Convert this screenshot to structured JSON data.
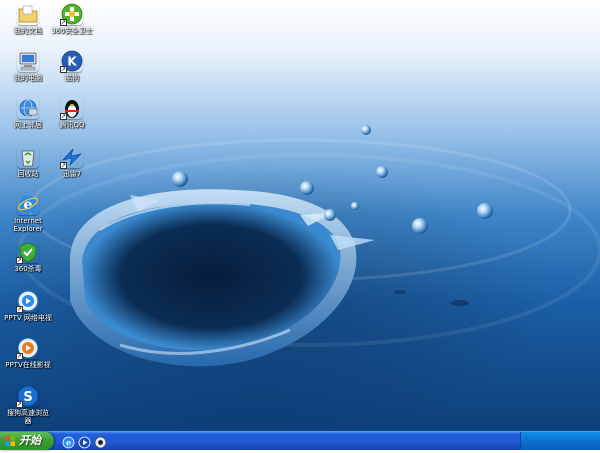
{
  "desktop": {
    "icons": [
      {
        "label": "我的文档",
        "icon": "folder-documents-icon",
        "shortcut": false
      },
      {
        "label": "360安全卫士",
        "icon": "shield-plus-icon",
        "shortcut": true
      },
      {
        "label": "我的电脑",
        "icon": "my-computer-icon",
        "shortcut": false
      },
      {
        "label": "酷狗",
        "icon": "kugou-music-icon",
        "shortcut": true
      },
      {
        "label": "网上邻居",
        "icon": "network-neighborhood-icon",
        "shortcut": false
      },
      {
        "label": "腾讯QQ",
        "icon": "qq-penguin-icon",
        "shortcut": true
      },
      {
        "label": "回收站",
        "icon": "recycle-bin-icon",
        "shortcut": false
      },
      {
        "label": "迅雷7",
        "icon": "thunder-bird-icon",
        "shortcut": true
      },
      {
        "label": "Internet Explorer",
        "icon": "internet-explorer-icon",
        "shortcut": false
      },
      {
        "label": "360杀毒",
        "icon": "antivirus-shield-icon",
        "shortcut": true
      },
      {
        "label": "PPTV 网络电视",
        "icon": "pptv-tv-icon",
        "shortcut": true
      },
      {
        "label": "PPTV在线影视",
        "icon": "pptv-movie-icon",
        "shortcut": true
      },
      {
        "label": "搜狗高速浏览器",
        "icon": "sogou-browser-icon",
        "shortcut": true
      }
    ]
  },
  "taskbar": {
    "start_label": "开始",
    "quicklaunch": [
      {
        "icon": "ie-quicklaunch-icon"
      },
      {
        "icon": "media-player-quicklaunch-icon"
      },
      {
        "icon": "qq-player-quicklaunch-icon"
      }
    ]
  },
  "colors": {
    "taskbar": "#245edb",
    "start_button": "#3c9e37",
    "tray": "#0c6fcd",
    "water_deep": "#0d3f78",
    "water_light": "#9cc4ea"
  }
}
